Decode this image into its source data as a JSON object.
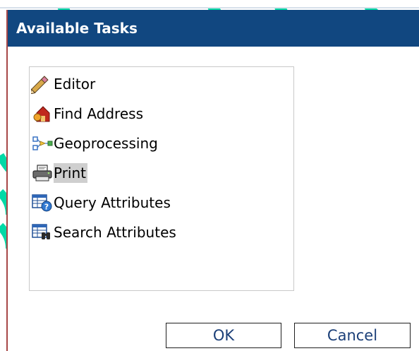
{
  "dialog": {
    "title": "Available Tasks"
  },
  "tasks": [
    {
      "label": "Editor",
      "icon": "pencil-icon",
      "selected": false
    },
    {
      "label": "Find Address",
      "icon": "house-pin-icon",
      "selected": false
    },
    {
      "label": "Geoprocessing",
      "icon": "model-flow-icon",
      "selected": false
    },
    {
      "label": "Print",
      "icon": "printer-icon",
      "selected": true
    },
    {
      "label": "Query Attributes",
      "icon": "query-table-icon",
      "selected": false
    },
    {
      "label": "Search Attributes",
      "icon": "search-table-icon",
      "selected": false
    }
  ],
  "buttons": {
    "ok_label": "OK",
    "cancel_label": "Cancel"
  },
  "colors": {
    "titlebar": "#114780",
    "selection": "#cfcfcf",
    "button_text": "#1b3f78",
    "decor_teal": "#00d9a6"
  }
}
